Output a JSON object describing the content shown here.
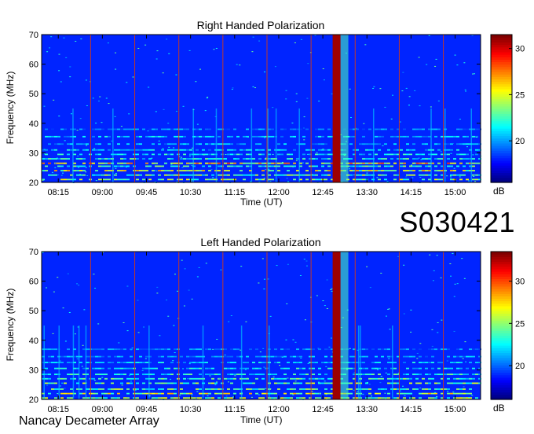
{
  "observation_id": "S030421",
  "instrument": "Nancay Decameter Array",
  "chart_data": [
    {
      "type": "heatmap",
      "title": "Right Handed Polarization",
      "xlabel": "Time (UT)",
      "ylabel": "Frequency (MHz)",
      "x_ticks": [
        "08:15",
        "09:00",
        "09:45",
        "10:30",
        "11:15",
        "12:00",
        "12:45",
        "13:30",
        "14:15",
        "15:00"
      ],
      "y_ticks": [
        20,
        30,
        40,
        50,
        60,
        70
      ],
      "ylim": [
        20,
        70
      ],
      "colorbar": {
        "label": "dB",
        "ticks": [
          20,
          25,
          30
        ],
        "range": [
          15.5,
          31.5
        ]
      },
      "time_markers": [
        "08:48",
        "09:33",
        "10:18",
        "11:03",
        "11:48",
        "12:33",
        "13:18",
        "14:03",
        "14:48"
      ],
      "burst": {
        "start": "12:55",
        "end": "13:03",
        "level_db": 31
      }
    },
    {
      "type": "heatmap",
      "title": "Left Handed Polarization",
      "xlabel": "Time (UT)",
      "ylabel": "Frequency (MHz)",
      "x_ticks": [
        "08:15",
        "09:00",
        "09:45",
        "10:30",
        "11:15",
        "12:00",
        "12:45",
        "13:30",
        "14:15",
        "15:00"
      ],
      "y_ticks": [
        20,
        30,
        40,
        50,
        60,
        70
      ],
      "ylim": [
        20,
        70
      ],
      "colorbar": {
        "label": "dB",
        "ticks": [
          20,
          25,
          30
        ],
        "range": [
          16,
          33.5
        ]
      },
      "time_markers": [
        "08:48",
        "09:33",
        "10:18",
        "11:03",
        "11:48",
        "12:33",
        "13:18",
        "14:03",
        "14:48"
      ],
      "burst": {
        "start": "12:55",
        "end": "13:03",
        "level_db": 33
      }
    }
  ]
}
